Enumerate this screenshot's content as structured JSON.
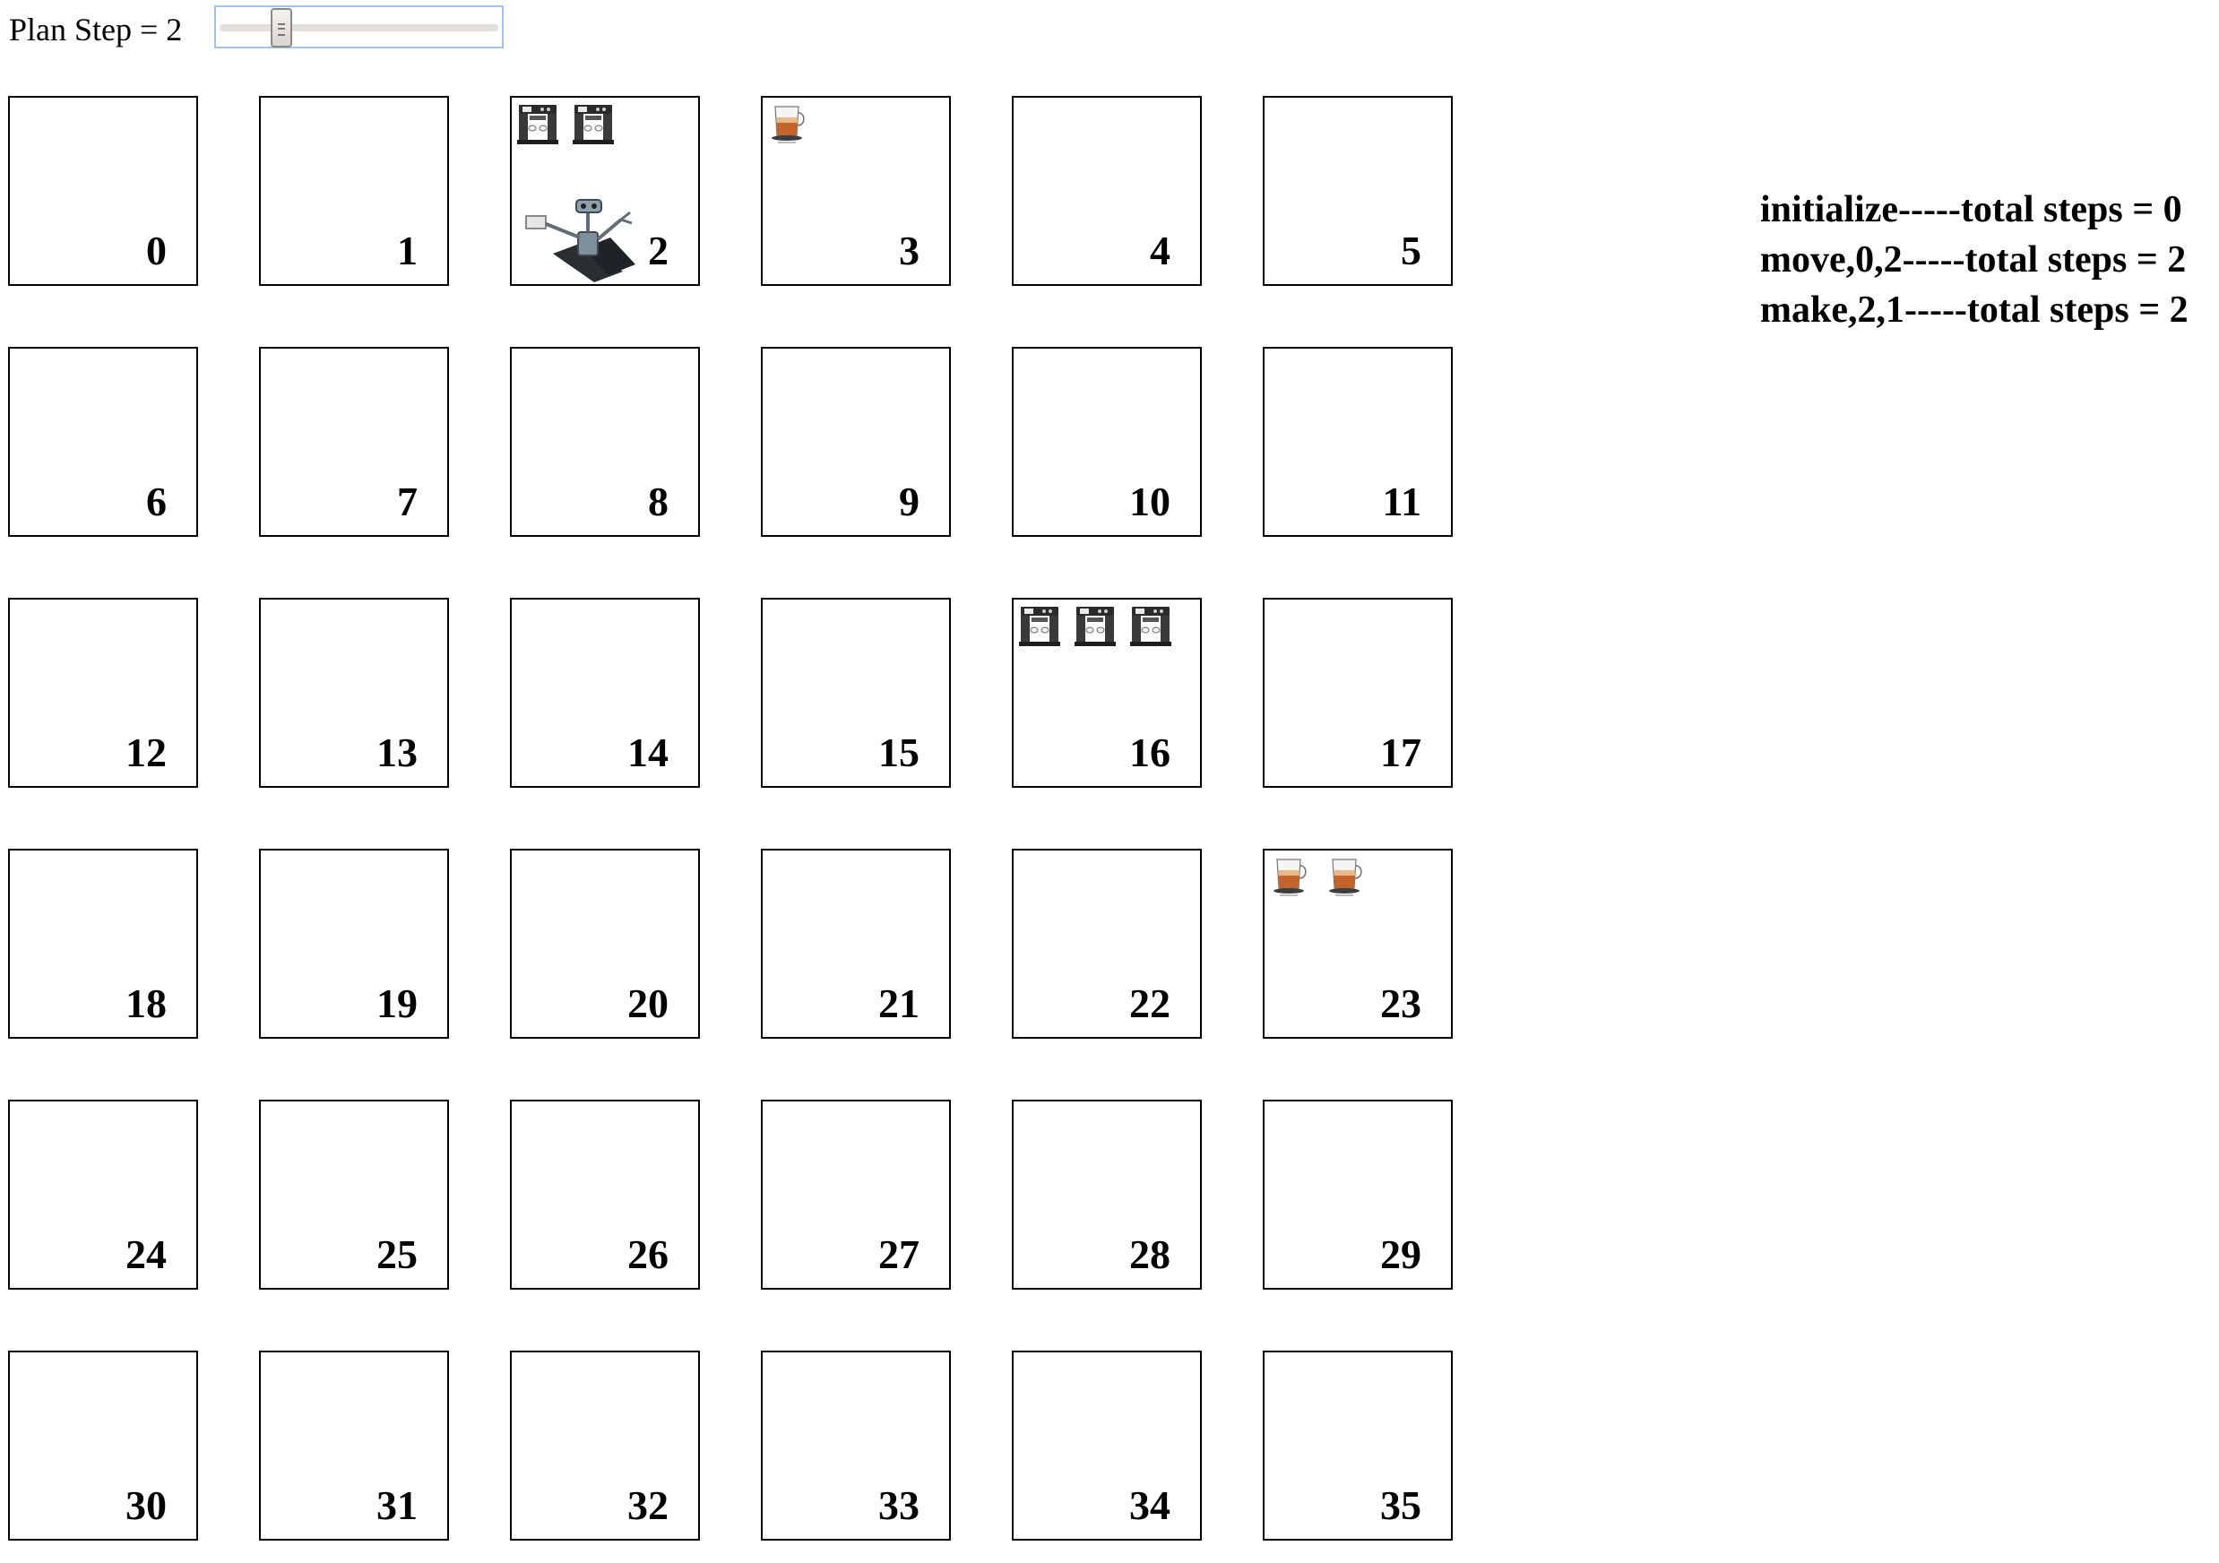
{
  "controls": {
    "step_label": "Plan Step = 2",
    "slider": {
      "min": 0,
      "max": 10,
      "value": 2
    }
  },
  "grid": {
    "cells": [
      {
        "label": "0",
        "items": []
      },
      {
        "label": "1",
        "items": []
      },
      {
        "label": "2",
        "items": [
          "coffee-machine",
          "coffee-machine"
        ],
        "robot": true
      },
      {
        "label": "3",
        "items": [
          "coffee-cup"
        ]
      },
      {
        "label": "4",
        "items": []
      },
      {
        "label": "5",
        "items": []
      },
      {
        "label": "6",
        "items": []
      },
      {
        "label": "7",
        "items": []
      },
      {
        "label": "8",
        "items": []
      },
      {
        "label": "9",
        "items": []
      },
      {
        "label": "10",
        "items": []
      },
      {
        "label": "11",
        "items": []
      },
      {
        "label": "12",
        "items": []
      },
      {
        "label": "13",
        "items": []
      },
      {
        "label": "14",
        "items": []
      },
      {
        "label": "15",
        "items": []
      },
      {
        "label": "16",
        "items": [
          "coffee-machine",
          "coffee-machine",
          "coffee-machine"
        ]
      },
      {
        "label": "17",
        "items": []
      },
      {
        "label": "18",
        "items": []
      },
      {
        "label": "19",
        "items": []
      },
      {
        "label": "20",
        "items": []
      },
      {
        "label": "21",
        "items": []
      },
      {
        "label": "22",
        "items": []
      },
      {
        "label": "23",
        "items": [
          "coffee-cup",
          "coffee-cup"
        ]
      },
      {
        "label": "24",
        "items": []
      },
      {
        "label": "25",
        "items": []
      },
      {
        "label": "26",
        "items": []
      },
      {
        "label": "27",
        "items": []
      },
      {
        "label": "28",
        "items": []
      },
      {
        "label": "29",
        "items": []
      },
      {
        "label": "30",
        "items": []
      },
      {
        "label": "31",
        "items": []
      },
      {
        "label": "32",
        "items": []
      },
      {
        "label": "33",
        "items": []
      },
      {
        "label": "34",
        "items": []
      },
      {
        "label": "35",
        "items": []
      }
    ]
  },
  "log": {
    "lines": [
      "initialize-----total steps = 0",
      "move,0,2-----total steps = 2",
      "make,2,1-----total steps = 2"
    ]
  }
}
